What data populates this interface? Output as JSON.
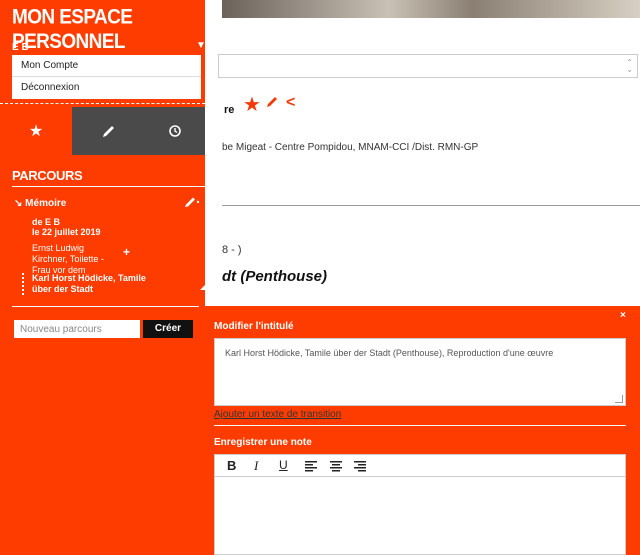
{
  "background_page": {
    "title_suffix": "re",
    "credit": "be Migeat - Centre Pompidou, MNAM-CCI /Dist. RMN-GP",
    "date_fragment": "8 - )",
    "work_title": "dt (Penthouse)",
    "accent_color": "#f33b0a"
  },
  "panel": {
    "title": "MON ESPACE PERSONNEL",
    "user_initials": "E B",
    "account_menu": [
      "Mon Compte",
      "Déconnexion"
    ],
    "tabs": [
      {
        "name": "favorites",
        "icon": "star-icon",
        "active": true
      },
      {
        "name": "notes",
        "icon": "pencil-icon",
        "active": false
      },
      {
        "name": "history",
        "icon": "history-icon",
        "active": false
      }
    ],
    "section_title": "PARCOURS",
    "journey": {
      "name": "Mémoire",
      "author": "de E B",
      "date": "le 22 juillet 2019",
      "steps": [
        {
          "label": "Ernst Ludwig Kirchner, Toilette - Frau vor dem",
          "add_symbol": "+"
        },
        {
          "label": "Karl Horst Hödicke, Tamile über der Stadt"
        }
      ]
    },
    "new_journey_placeholder": "Nouveau parcours",
    "create_label": "Créer",
    "colors": {
      "panel": "#ff3c00",
      "tab_dark": "#4a4a4a"
    }
  },
  "popup": {
    "close_symbol": "×",
    "title_label": "Modifier l'intitulé",
    "title_value": "Karl Horst Hödicke, Tamile über der Stadt (Penthouse), Reproduction d'une œuvre",
    "add_transition_label": "Ajouter un texte de transition",
    "note_label": "Enregistrer une note",
    "toolbar": {
      "bold": "B",
      "italic": "I",
      "underline": "U"
    }
  }
}
